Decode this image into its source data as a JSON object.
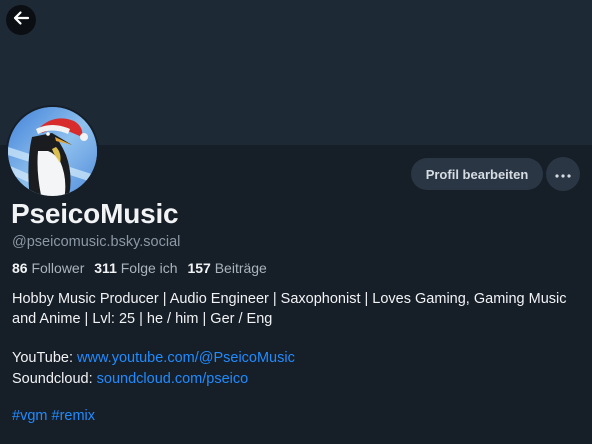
{
  "header": {
    "back_icon": "arrow-left-icon"
  },
  "profile": {
    "avatar_icon": "penguin-santa-hat-avatar",
    "display_name": "PseicoMusic",
    "handle": "@pseicomusic.bsky.social",
    "stats": {
      "followers_count": "86",
      "followers_label": "Follower",
      "following_count": "311",
      "following_label": "Folge ich",
      "posts_count": "157",
      "posts_label": "Beiträge"
    },
    "bio": "Hobby Music Producer | Audio Engineer | Saxophonist | Loves Gaming, Gaming Music and Anime | Lvl: 25 | he / him | Ger / Eng",
    "links": {
      "youtube_label": "YouTube:",
      "youtube_url": "www.youtube.com/@PseicoMusic",
      "soundcloud_label": "Soundcloud:",
      "soundcloud_url": "soundcloud.com/pseico"
    },
    "tags": [
      "#vgm",
      "#remix"
    ]
  },
  "actions": {
    "edit_label": "Profil bearbeiten",
    "more_icon": "ellipsis-icon"
  },
  "colors": {
    "background": "#161e27",
    "banner": "#1e2936",
    "link": "#208bfe",
    "button": "#2a3644"
  }
}
